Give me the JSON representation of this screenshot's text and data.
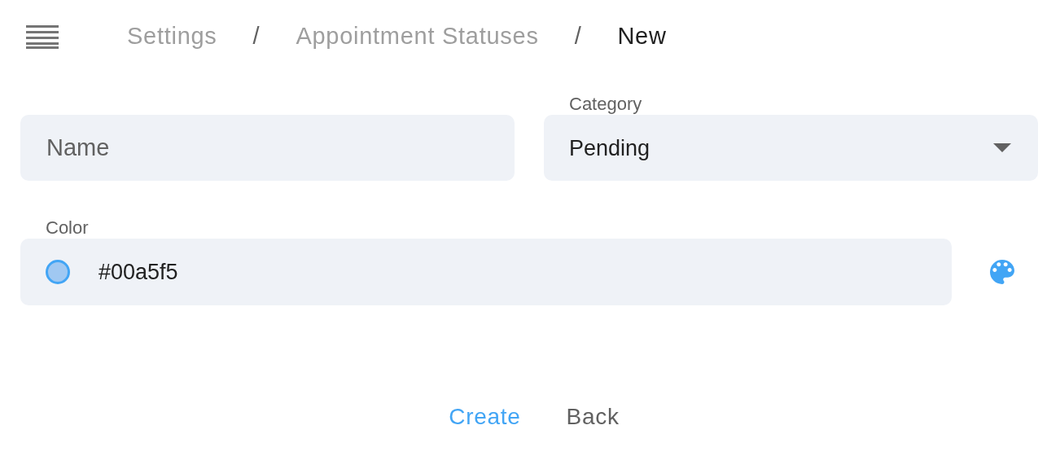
{
  "breadcrumb": [
    {
      "label": "Settings",
      "current": false
    },
    {
      "label": "Appointment Statuses",
      "current": false
    },
    {
      "label": "New",
      "current": true
    }
  ],
  "separator": "/",
  "name_field": {
    "placeholder": "Name"
  },
  "category_field": {
    "label": "Category",
    "value": "Pending"
  },
  "color_field": {
    "label": "Color",
    "value": "#00a5f5"
  },
  "buttons": [
    {
      "label": "Create",
      "kind": "primary"
    },
    {
      "label": "Back",
      "kind": "secondary"
    }
  ]
}
